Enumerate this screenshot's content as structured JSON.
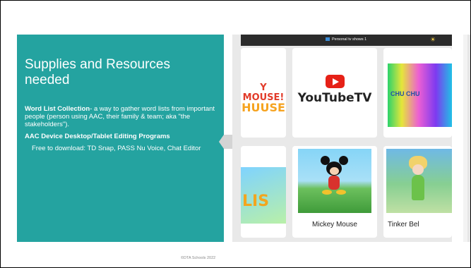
{
  "slide": {
    "title": "Supplies and Resources needed",
    "bullets": [
      {
        "bold": "Word List Collection",
        "text": "- a way to gather word lists from important people (person using AAC, their family & team; aka \"the stakeholders\")."
      },
      {
        "bold": "AAC Device Desktop/Tablet Editing Programs",
        "text": ""
      }
    ],
    "sub_bullet": "Free to download: TD Snap, PASS Nu Voice, Chat Editor",
    "footer": "©DTA Schools 2022"
  },
  "screenshot": {
    "status_title": "Personal tv shows 1",
    "status_icon": "lightbulb-icon",
    "tiles": [
      {
        "art_text": "Y MOUSE!",
        "art_text_2": "HUUSE"
      },
      {
        "logo_text": "YouTubeTV"
      },
      {
        "art_text": "CHU CHU"
      },
      {
        "art_text": "LIS"
      },
      {
        "label": "Mickey Mouse"
      },
      {
        "label": "Tinker Bel"
      }
    ]
  },
  "colors": {
    "panel": "#24a3a0",
    "youtube_red": "#e62117",
    "status_bar": "#2b2b2b"
  }
}
